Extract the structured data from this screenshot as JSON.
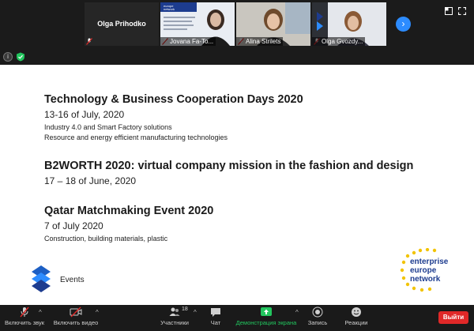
{
  "participants": [
    {
      "name": "Olga Prihodko"
    },
    {
      "name": "Jovana Fa-To..."
    },
    {
      "name": "Alina Strilets"
    },
    {
      "name": "Olga Gvozdy..."
    }
  ],
  "slide": {
    "events": [
      {
        "title": "Technology & Business Cooperation Days 2020",
        "date": "13-16 of July, 2020",
        "lines": [
          "Industry 4.0 and Smart Factory solutions",
          "Resource and energy efficient manufacturing technologies"
        ]
      },
      {
        "title": "B2WORTH 2020: virtual company mission in the fashion and design",
        "date": "17 – 18 of June, 2020",
        "lines": []
      },
      {
        "title": "Qatar Matchmaking Event 2020",
        "date": "7 of July 2020",
        "lines": [
          "Construction, building materials, plastic"
        ]
      }
    ],
    "footer_label": "Events",
    "brand_logo_text": [
      "enterprise",
      "europe",
      "network"
    ]
  },
  "toolbar": {
    "audio_label": "Включить звук",
    "video_label": "Включить видео",
    "participants_label": "Участники",
    "participants_count": "18",
    "chat_label": "Чат",
    "share_label": "Демонстрация экрана",
    "record_label": "Запись",
    "reactions_label": "Реакции",
    "leave_label": "Выйти"
  },
  "colors": {
    "accent": "#2d8cff",
    "share_green": "#22c55e",
    "leave_red": "#e02828",
    "brand_blue": "#1d3c8f",
    "brand_yellow": "#f2c300"
  }
}
